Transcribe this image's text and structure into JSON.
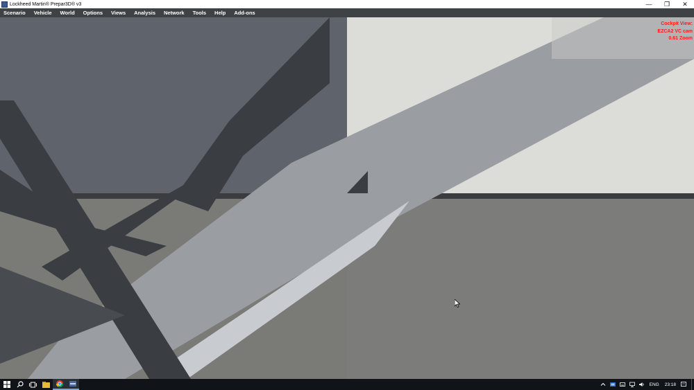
{
  "window": {
    "title": "Lockheed Martin® Prepar3D® v3",
    "controls": [
      "minimize",
      "restore",
      "close"
    ],
    "minimize_glyph": "—",
    "restore_glyph": "❐",
    "close_glyph": "✕"
  },
  "menu": {
    "items": [
      "Scenario",
      "Vehicle",
      "World",
      "Options",
      "Views",
      "Analysis",
      "Network",
      "Tools",
      "Help",
      "Add-ons"
    ]
  },
  "hud": {
    "line1": "Cockpit View:",
    "line2": "EZCA2 VC cam",
    "line3": "0.61 Zoom",
    "color": "#ff1a1a"
  },
  "taskbar": {
    "buttons": [
      "start-icon",
      "search-icon",
      "task-view-icon",
      "file-explorer-icon",
      "chrome-icon",
      "prepar3d-icon"
    ],
    "tray": {
      "language": "ENG",
      "time": "23:18",
      "icons": [
        "chevron-up-icon",
        "display-icon",
        "keyboard-icon",
        "network-icon",
        "volume-icon"
      ]
    }
  },
  "colors": {
    "menubar": "#3f4245",
    "taskbar": "#101418",
    "hud_text": "#ff1a1a"
  }
}
